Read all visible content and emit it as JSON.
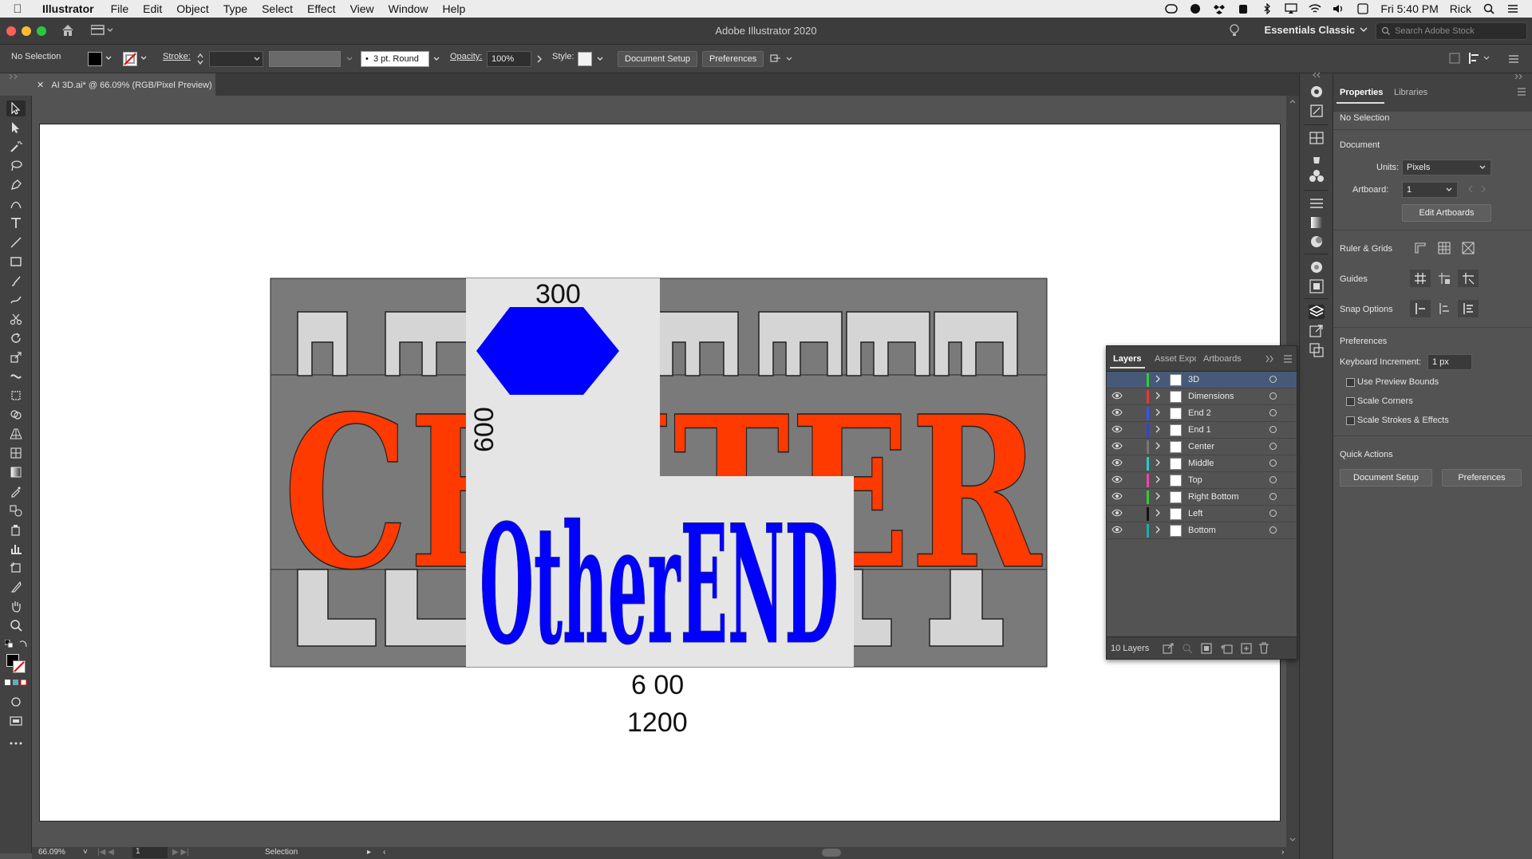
{
  "menubar": {
    "app": "Illustrator",
    "items": [
      "File",
      "Edit",
      "Object",
      "Type",
      "Select",
      "Effect",
      "View",
      "Window",
      "Help"
    ],
    "clock": "Fri 5:40 PM",
    "user": "Rick"
  },
  "titlebar": {
    "title": "Adobe Illustrator 2020",
    "workspace": "Essentials Classic",
    "search_placeholder": "Search Adobe Stock"
  },
  "controlbar": {
    "selection": "No Selection",
    "stroke_label": "Stroke:",
    "brush": "3 pt. Round",
    "opacity_label": "Opacity:",
    "opacity_value": "100%",
    "style_label": "Style:",
    "document_setup": "Document Setup",
    "preferences": "Preferences"
  },
  "document": {
    "tab_title": "AI 3D.ai* @ 66.09% (RGB/Pixel Preview)",
    "zoom": "66.09%",
    "artboard_number": "1",
    "status_tool": "Selection"
  },
  "artwork": {
    "banner_word": "CENTER",
    "other_word": "OtherEND",
    "dim_top": "300",
    "dim_side": "600",
    "dim_bottom1": "6 00",
    "dim_bottom2": "1200",
    "colors": {
      "orange": "#ff3a00",
      "blue": "#0000ff",
      "gray": "#7a7a7a",
      "light": "#e5e5e5"
    }
  },
  "layers_panel": {
    "tabs": [
      "Layers",
      "Asset Expo",
      "Artboards"
    ],
    "layers": [
      {
        "name": "3D",
        "color": "#33cc33",
        "selected": true,
        "visible": false
      },
      {
        "name": "Dimensions",
        "color": "#ee3333",
        "selected": false,
        "visible": true
      },
      {
        "name": "End 2",
        "color": "#3355ff",
        "selected": false,
        "visible": true
      },
      {
        "name": "End 1",
        "color": "#3344cc",
        "selected": false,
        "visible": true
      },
      {
        "name": "Center",
        "color": "#777777",
        "selected": false,
        "visible": true
      },
      {
        "name": "Middle",
        "color": "#22cccc",
        "selected": false,
        "visible": true
      },
      {
        "name": "Top",
        "color": "#ee44aa",
        "selected": false,
        "visible": true
      },
      {
        "name": "Right Bottom",
        "color": "#33cc33",
        "selected": false,
        "visible": true
      },
      {
        "name": "Left",
        "color": "#111111",
        "selected": false,
        "visible": true
      },
      {
        "name": "Bottom",
        "color": "#22aaaa",
        "selected": false,
        "visible": true
      }
    ],
    "count": "10 Layers"
  },
  "properties": {
    "tabs": [
      "Properties",
      "Libraries"
    ],
    "selection": "No Selection",
    "document_heading": "Document",
    "units_label": "Units:",
    "units_value": "Pixels",
    "artboard_label": "Artboard:",
    "artboard_value": "1",
    "edit_artboards": "Edit Artboards",
    "ruler_grids": "Ruler & Grids",
    "guides": "Guides",
    "snap_options": "Snap Options",
    "preferences_heading": "Preferences",
    "keyboard_increment_label": "Keyboard Increment:",
    "keyboard_increment_value": "1 px",
    "use_preview_bounds": "Use Preview Bounds",
    "scale_corners": "Scale Corners",
    "scale_strokes": "Scale Strokes & Effects",
    "quick_actions": "Quick Actions",
    "document_setup": "Document Setup",
    "preferences": "Preferences"
  }
}
